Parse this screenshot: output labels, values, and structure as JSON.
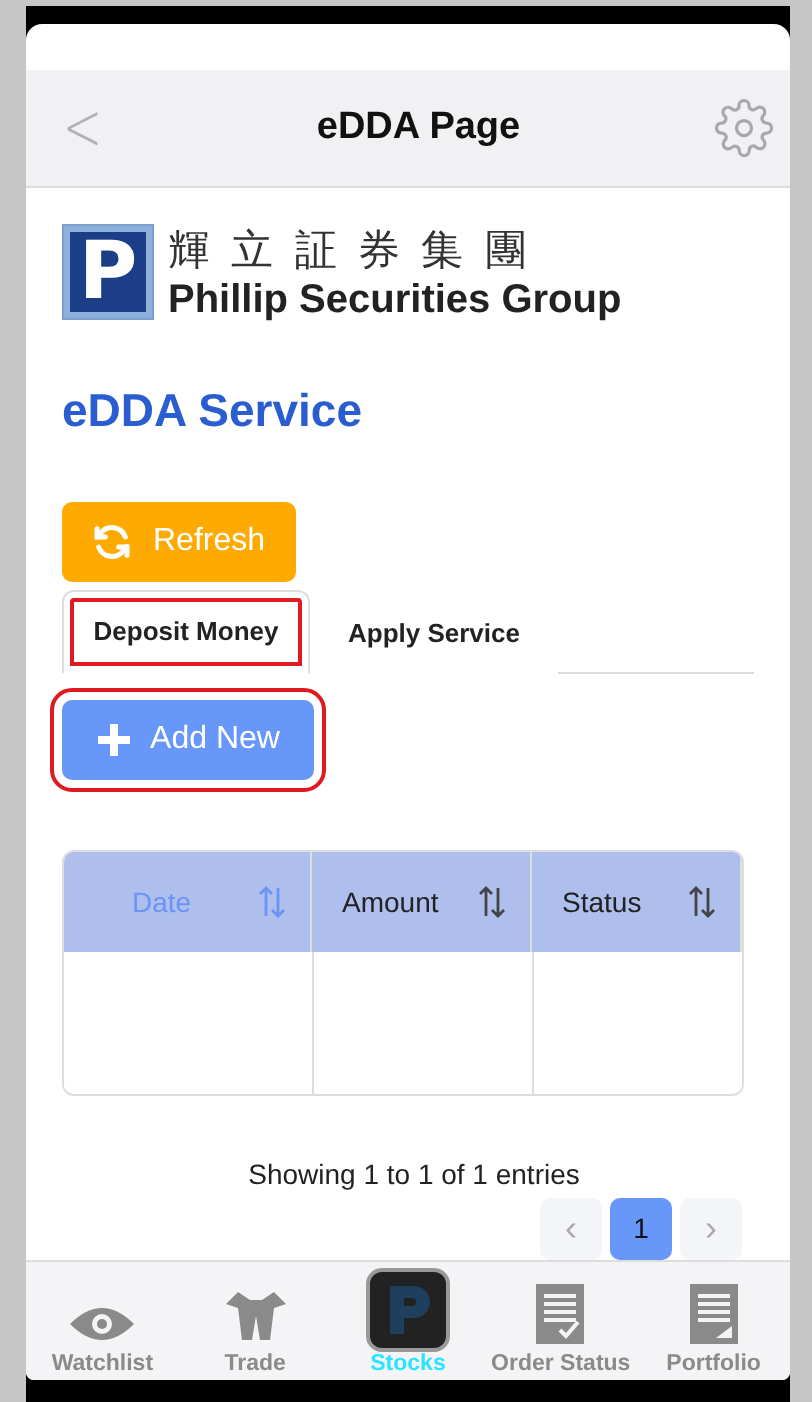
{
  "header": {
    "back": "<",
    "title": "eDDA Page"
  },
  "logo": {
    "chinese": "輝 立 証 券 集 團",
    "english": "Phillip Securities Group",
    "mark": "P"
  },
  "heading": "eDDA Service",
  "refresh_button": "Refresh",
  "tabs": [
    {
      "label": "Deposit Money",
      "selected": true,
      "highlighted": true
    },
    {
      "label": "Apply Service",
      "selected": false,
      "highlighted": false
    }
  ],
  "add_button": {
    "label": "Add New",
    "highlighted": true
  },
  "table": {
    "columns": [
      {
        "label": "Date",
        "sorted": true
      },
      {
        "label": "Amount",
        "sorted": false
      },
      {
        "label": "Status",
        "sorted": false
      }
    ]
  },
  "info": "Showing 1 to 1 of 1 entries",
  "pagination": {
    "prev": "‹",
    "pages": [
      {
        "label": "1",
        "selected": true
      }
    ],
    "next": "›"
  },
  "nav": [
    {
      "label": "Watchlist",
      "selected": false
    },
    {
      "label": "Trade",
      "selected": false
    },
    {
      "label": "Stocks",
      "selected": true
    },
    {
      "label": "Order Status",
      "selected": false
    },
    {
      "label": "Portfolio",
      "selected": false
    }
  ]
}
